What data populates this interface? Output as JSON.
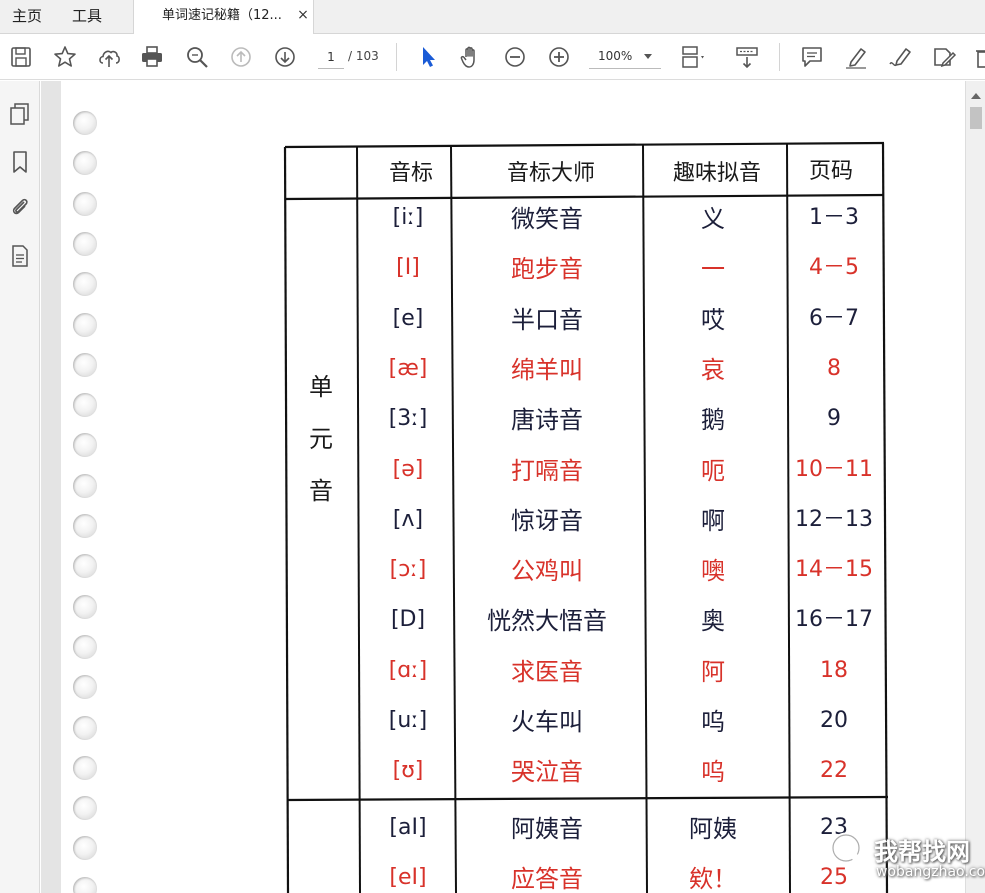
{
  "tabs": {
    "home": "主页",
    "tools": "工具",
    "document": "单词速记秘籍（12...",
    "close": "×"
  },
  "toolbar": {
    "current_page": "1",
    "page_total": "/ 103",
    "zoom": "100%",
    "icons": [
      "save-icon",
      "star-icon",
      "upload-cloud-icon",
      "print-icon",
      "zoom-search-icon",
      "page-up-icon",
      "page-down-icon",
      "select-cursor-icon",
      "hand-icon",
      "zoom-out-icon",
      "zoom-in-icon",
      "fit-page-icon",
      "read-mode-icon",
      "comment-icon",
      "highlight-pen-icon",
      "sign-icon",
      "edit-tool-icon",
      "delete-icon"
    ]
  },
  "left_panel": {
    "icons": [
      "page-thumbnails-icon",
      "bookmark-icon",
      "attachment-icon",
      "document-properties-icon"
    ]
  },
  "table": {
    "headers": [
      "音标",
      "音标大师",
      "趣味拟音",
      "页码"
    ],
    "category_1": [
      "单",
      "元",
      "音"
    ],
    "rows": [
      {
        "symbol": "[iː]",
        "name": "微笑音",
        "sound": "义",
        "pages": "1－3",
        "ink": "black"
      },
      {
        "symbol": "[I]",
        "name": "跑步音",
        "sound": "一",
        "pages": "4－5",
        "ink": "red"
      },
      {
        "symbol": "[e]",
        "name": "半口音",
        "sound": "哎",
        "pages": "6－7",
        "ink": "black"
      },
      {
        "symbol": "[æ]",
        "name": "绵羊叫",
        "sound": "哀",
        "pages": "8",
        "ink": "red"
      },
      {
        "symbol": "[3ː]",
        "name": "唐诗音",
        "sound": "鹅",
        "pages": "9",
        "ink": "black"
      },
      {
        "symbol": "[ə]",
        "name": "打嗝音",
        "sound": "呃",
        "pages": "10－11",
        "ink": "red"
      },
      {
        "symbol": "[ʌ]",
        "name": "惊讶音",
        "sound": "啊",
        "pages": "12－13",
        "ink": "black"
      },
      {
        "symbol": "[ɔː]",
        "name": "公鸡叫",
        "sound": "噢",
        "pages": "14－15",
        "ink": "red"
      },
      {
        "symbol": "[D]",
        "name": "恍然大悟音",
        "sound": "奥",
        "pages": "16－17",
        "ink": "black"
      },
      {
        "symbol": "[ɑː]",
        "name": "求医音",
        "sound": "阿",
        "pages": "18",
        "ink": "red"
      },
      {
        "symbol": "[uː]",
        "name": "火车叫",
        "sound": "呜",
        "pages": "20",
        "ink": "black"
      },
      {
        "symbol": "[ʊ]",
        "name": "哭泣音",
        "sound": "呜",
        "pages": "22",
        "ink": "red"
      },
      {
        "symbol": "[aI]",
        "name": "阿姨音",
        "sound": "阿姨",
        "pages": "23",
        "ink": "black"
      },
      {
        "symbol": "[eI]",
        "name": "应答音",
        "sound": "欸！",
        "pages": "25",
        "ink": "red"
      }
    ]
  },
  "watermark": {
    "cn": "我帮找网",
    "en": "wobangzhao.com"
  },
  "colors": {
    "ink_black": "#1c1f3a",
    "ink_red": "#d8322a",
    "accent_blue": "#1a5bd6"
  }
}
